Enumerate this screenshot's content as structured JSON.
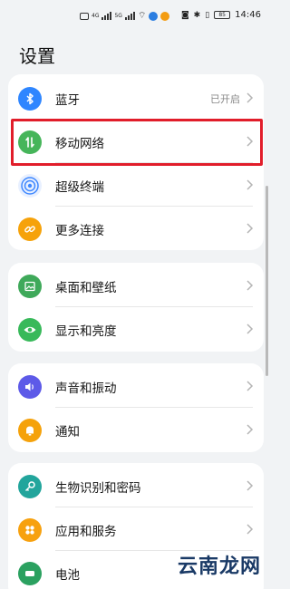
{
  "status_bar": {
    "time": "14:46",
    "battery": "85",
    "sim1": "4G",
    "sim2": "5G"
  },
  "page_title": "设置",
  "colors": {
    "bluetooth": "#2f86ff",
    "mobile_network": "#46b55a",
    "super_device": "#3f88ff",
    "more_connections": "#f6a20a",
    "wallpaper": "#3fa95a",
    "display": "#38b95a",
    "sound": "#5d5ae8",
    "notification": "#f5a20b",
    "biometrics": "#22a59c",
    "apps": "#f7a10f",
    "battery": "#2ba160",
    "highlight": "#e11d2a"
  },
  "groups": [
    {
      "items": [
        {
          "label": "蓝牙",
          "value": "已开启",
          "icon": "bluetooth-icon"
        },
        {
          "label": "移动网络",
          "value": "",
          "icon": "mobile-network-icon"
        },
        {
          "label": "超级终端",
          "value": "",
          "icon": "super-device-icon"
        },
        {
          "label": "更多连接",
          "value": "",
          "icon": "link-icon"
        }
      ]
    },
    {
      "items": [
        {
          "label": "桌面和壁纸",
          "value": "",
          "icon": "wallpaper-icon"
        },
        {
          "label": "显示和亮度",
          "value": "",
          "icon": "eye-icon"
        }
      ]
    },
    {
      "items": [
        {
          "label": "声音和振动",
          "value": "",
          "icon": "speaker-icon"
        },
        {
          "label": "通知",
          "value": "",
          "icon": "bell-icon"
        }
      ]
    },
    {
      "items": [
        {
          "label": "生物识别和密码",
          "value": "",
          "icon": "key-icon"
        },
        {
          "label": "应用和服务",
          "value": "",
          "icon": "apps-grid-icon"
        },
        {
          "label": "电池",
          "value": "",
          "icon": "battery-icon"
        }
      ]
    }
  ],
  "watermark": "云南龙网"
}
